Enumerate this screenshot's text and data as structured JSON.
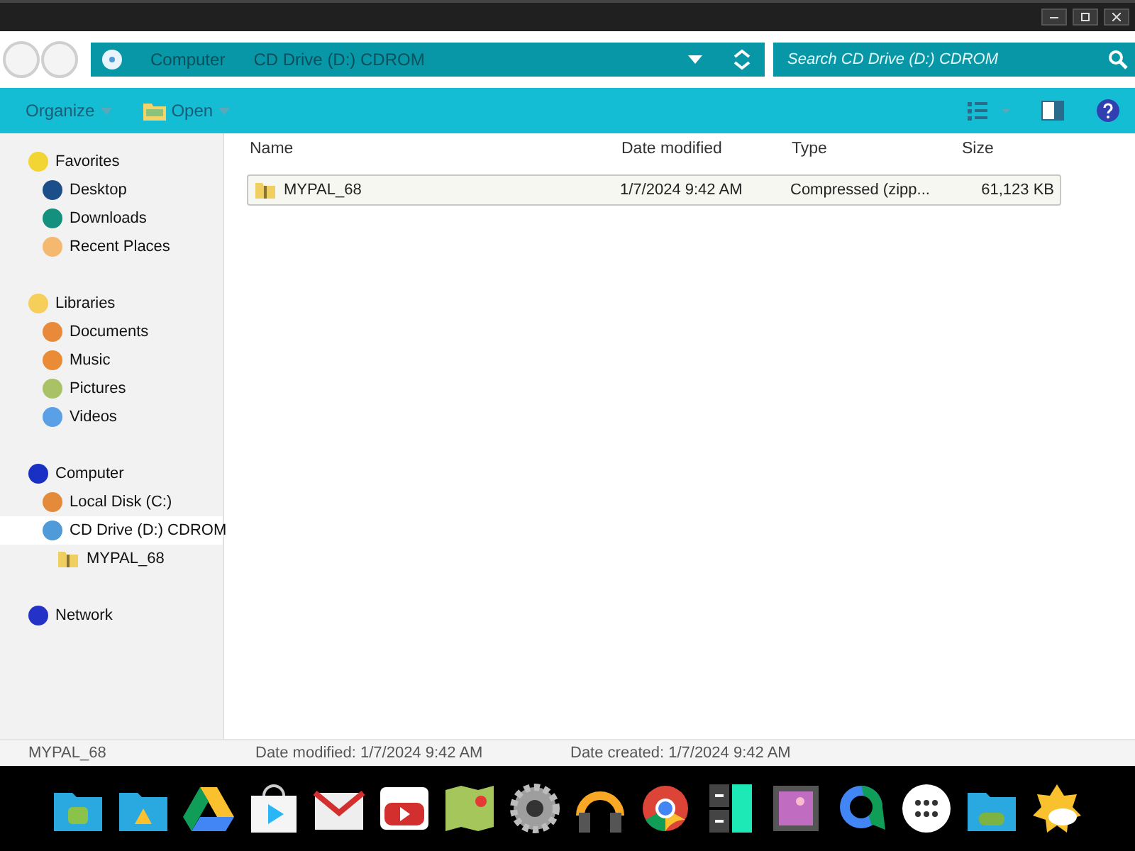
{
  "address": {
    "crumbs": [
      "Computer",
      "CD Drive (D:) CDROM"
    ]
  },
  "search": {
    "placeholder": "Search CD Drive (D:) CDROM"
  },
  "toolbar": [
    "Organize",
    "Open"
  ],
  "nav": [
    {
      "label": "Favorites",
      "color": "#f2d433",
      "selected": false,
      "children": [
        {
          "label": "Desktop",
          "color": "#1c4f8a",
          "selected": false
        },
        {
          "label": "Downloads",
          "color": "#14917e",
          "selected": false
        },
        {
          "label": "Recent Places",
          "color": "#f5b870",
          "selected": false
        }
      ]
    },
    {
      "label": "Libraries",
      "color": "#f6cf5a",
      "selected": false,
      "children": [
        {
          "label": "Documents",
          "color": "#e9893a",
          "selected": false
        },
        {
          "label": "Music",
          "color": "#e98c35",
          "selected": false
        },
        {
          "label": "Pictures",
          "color": "#a8c265",
          "selected": false
        },
        {
          "label": "Videos",
          "color": "#5aa0e6",
          "selected": false
        }
      ]
    },
    {
      "label": "Computer",
      "color": "#1a2fc4",
      "selected": false,
      "children": [
        {
          "label": "Local Disk (C:)",
          "color": "#e38b3a",
          "selected": false
        },
        {
          "label": "CD Drive (D:) CDROM",
          "color": "#4f9ad8",
          "selected": true,
          "children": [
            {
              "label": "MYPAL_68",
              "kind": "zip",
              "selected": false
            }
          ]
        }
      ]
    },
    {
      "label": "Network",
      "color": "#2532c8",
      "selected": false
    }
  ],
  "columns": [
    "Name",
    "Date modified",
    "Type",
    "Size"
  ],
  "rows": [
    {
      "name": "MYPAL_68",
      "modified": "1/7/2024 9:42 AM",
      "type": "Compressed (zipp...",
      "size": "61,123 KB",
      "selected": true
    }
  ],
  "status": {
    "name": "MYPAL_68",
    "modified": "Date modified: 1/7/2024 9:42 AM",
    "created": "Date created: 1/7/2024 9:42 AM"
  },
  "dock": [
    {
      "kind": "android-folder"
    },
    {
      "kind": "drive-folder"
    },
    {
      "kind": "drive"
    },
    {
      "kind": "store"
    },
    {
      "kind": "mail"
    },
    {
      "kind": "video"
    },
    {
      "kind": "maps"
    },
    {
      "kind": "settings"
    },
    {
      "kind": "music"
    },
    {
      "kind": "browser"
    },
    {
      "kind": "calculator"
    },
    {
      "kind": "gallery"
    },
    {
      "kind": "chat"
    },
    {
      "kind": "apps"
    },
    {
      "kind": "games-folder"
    },
    {
      "kind": "weather"
    }
  ]
}
